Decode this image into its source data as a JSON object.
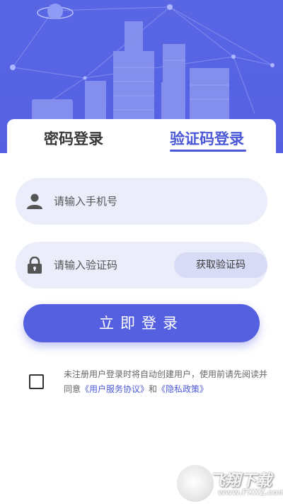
{
  "header": {
    "bg_color": "#5866e4"
  },
  "tabs": [
    {
      "label": "密码登录",
      "active": false
    },
    {
      "label": "验证码登录",
      "active": true
    }
  ],
  "form": {
    "phone_placeholder": "请输入手机号",
    "code_placeholder": "请输入验证码",
    "get_code_label": "获取验证码",
    "login_label": "立即登录"
  },
  "agreement": {
    "checked": false,
    "text": "未注册用户登录时将自动创建用户，使用前请先阅读并同意",
    "terms_link": "《用户服务协议》",
    "and": "和",
    "privacy_link": "《隐私政策》"
  },
  "watermark": {
    "title": "飞翔下载",
    "url": "www.FXXZ.com"
  },
  "colors": {
    "accent": "#5460df",
    "field_bg": "#ebedfb",
    "code_btn_bg": "#d7dbf5"
  }
}
